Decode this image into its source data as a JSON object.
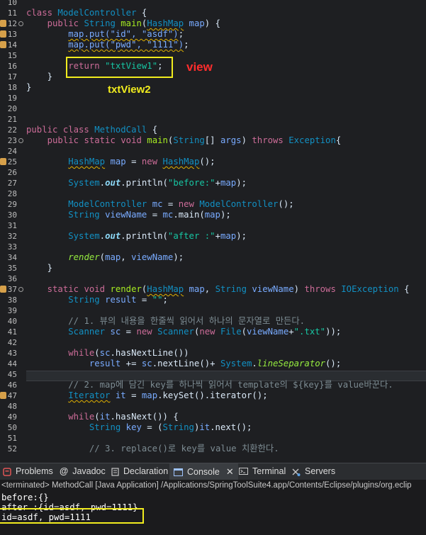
{
  "annotations": {
    "view_label": "view",
    "txtview2_label": "txtView2"
  },
  "colors": {
    "annotation_box": "#f1ec1e",
    "annotation_red": "#ff2d2d",
    "editor_bg": "#1e1f22"
  },
  "editor": {
    "lines": [
      {
        "n": "10",
        "segs": []
      },
      {
        "n": "11",
        "segs": [
          {
            "c": "kw",
            "t": "class "
          },
          {
            "c": "typ",
            "t": "ModelController"
          },
          {
            "t": " {"
          }
        ]
      },
      {
        "n": "12",
        "marker": true,
        "fold": true,
        "segs": [
          {
            "t": "    "
          },
          {
            "c": "kw",
            "t": "public "
          },
          {
            "c": "typ",
            "t": "String "
          },
          {
            "c": "meth",
            "t": "main"
          },
          {
            "t": "("
          },
          {
            "c": "typ warn",
            "t": "HashMap"
          },
          {
            "t": " "
          },
          {
            "c": "var",
            "t": "map"
          },
          {
            "t": ") {"
          }
        ]
      },
      {
        "n": "13",
        "marker": true,
        "segs": [
          {
            "t": "        "
          },
          {
            "c": "var warn",
            "t": "map.put(\"id\", \"asdf\")"
          },
          {
            "t": ";"
          }
        ]
      },
      {
        "n": "14",
        "marker": true,
        "segs": [
          {
            "t": "        "
          },
          {
            "c": "var warn",
            "t": "map.put(\"pwd\", \"1111\")"
          },
          {
            "t": ";"
          }
        ]
      },
      {
        "n": "15",
        "segs": []
      },
      {
        "n": "16",
        "segs": [
          {
            "t": "        "
          },
          {
            "c": "kw",
            "t": "return "
          },
          {
            "c": "str",
            "t": "\"txtView1\""
          },
          {
            "t": ";"
          }
        ]
      },
      {
        "n": "17",
        "segs": [
          {
            "t": "    }"
          }
        ]
      },
      {
        "n": "18",
        "segs": [
          {
            "t": "}"
          }
        ]
      },
      {
        "n": "19",
        "segs": []
      },
      {
        "n": "20",
        "segs": []
      },
      {
        "n": "21",
        "segs": []
      },
      {
        "n": "22",
        "segs": [
          {
            "c": "kw",
            "t": "public class "
          },
          {
            "c": "typ",
            "t": "MethodCall"
          },
          {
            "t": " {"
          }
        ]
      },
      {
        "n": "23",
        "fold": true,
        "segs": [
          {
            "t": "    "
          },
          {
            "c": "kw",
            "t": "public static void "
          },
          {
            "c": "meth",
            "t": "main"
          },
          {
            "t": "("
          },
          {
            "c": "typ",
            "t": "String"
          },
          {
            "t": "[] "
          },
          {
            "c": "var",
            "t": "args"
          },
          {
            "t": ") "
          },
          {
            "c": "kw",
            "t": "throws "
          },
          {
            "c": "typ",
            "t": "Exception"
          },
          {
            "t": "{"
          }
        ]
      },
      {
        "n": "24",
        "segs": []
      },
      {
        "n": "25",
        "marker": true,
        "segs": [
          {
            "t": "        "
          },
          {
            "c": "typ warn",
            "t": "HashMap"
          },
          {
            "t": " "
          },
          {
            "c": "var",
            "t": "map"
          },
          {
            "t": " = "
          },
          {
            "c": "kw",
            "t": "new "
          },
          {
            "c": "typ warn",
            "t": "HashMap"
          },
          {
            "t": "();"
          }
        ]
      },
      {
        "n": "26",
        "segs": []
      },
      {
        "n": "27",
        "segs": [
          {
            "t": "        "
          },
          {
            "c": "typ",
            "t": "System"
          },
          {
            "t": "."
          },
          {
            "c": "field",
            "t": "out"
          },
          {
            "t": ".println("
          },
          {
            "c": "str",
            "t": "\"before:\""
          },
          {
            "t": "+"
          },
          {
            "c": "var",
            "t": "map"
          },
          {
            "t": ");"
          }
        ]
      },
      {
        "n": "28",
        "segs": []
      },
      {
        "n": "29",
        "segs": [
          {
            "t": "        "
          },
          {
            "c": "typ",
            "t": "ModelController "
          },
          {
            "c": "var",
            "t": "mc"
          },
          {
            "t": " = "
          },
          {
            "c": "kw",
            "t": "new "
          },
          {
            "c": "typ",
            "t": "ModelController"
          },
          {
            "t": "();"
          }
        ]
      },
      {
        "n": "30",
        "segs": [
          {
            "t": "        "
          },
          {
            "c": "typ",
            "t": "String "
          },
          {
            "c": "var",
            "t": "viewName"
          },
          {
            "t": " = "
          },
          {
            "c": "var",
            "t": "mc"
          },
          {
            "t": ".main("
          },
          {
            "c": "var",
            "t": "map"
          },
          {
            "t": ");"
          }
        ]
      },
      {
        "n": "31",
        "segs": []
      },
      {
        "n": "32",
        "segs": [
          {
            "t": "        "
          },
          {
            "c": "typ",
            "t": "System"
          },
          {
            "t": "."
          },
          {
            "c": "field",
            "t": "out"
          },
          {
            "t": ".println("
          },
          {
            "c": "str",
            "t": "\"after :\""
          },
          {
            "t": "+"
          },
          {
            "c": "var",
            "t": "map"
          },
          {
            "t": ");"
          }
        ]
      },
      {
        "n": "33",
        "segs": []
      },
      {
        "n": "34",
        "segs": [
          {
            "t": "        "
          },
          {
            "c": "ital",
            "t": "render"
          },
          {
            "t": "("
          },
          {
            "c": "var",
            "t": "map"
          },
          {
            "t": ", "
          },
          {
            "c": "var",
            "t": "viewName"
          },
          {
            "t": ");"
          }
        ]
      },
      {
        "n": "35",
        "segs": [
          {
            "t": "    }"
          }
        ]
      },
      {
        "n": "36",
        "segs": []
      },
      {
        "n": "37",
        "marker": true,
        "fold": true,
        "segs": [
          {
            "t": "    "
          },
          {
            "c": "kw",
            "t": "static void "
          },
          {
            "c": "meth",
            "t": "render"
          },
          {
            "t": "("
          },
          {
            "c": "typ warn",
            "t": "HashMap"
          },
          {
            "t": " "
          },
          {
            "c": "var",
            "t": "map"
          },
          {
            "t": ", "
          },
          {
            "c": "typ",
            "t": "String "
          },
          {
            "c": "var",
            "t": "viewName"
          },
          {
            "t": ") "
          },
          {
            "c": "kw",
            "t": "throws "
          },
          {
            "c": "typ",
            "t": "IOException"
          },
          {
            "t": " {"
          }
        ]
      },
      {
        "n": "38",
        "segs": [
          {
            "t": "        "
          },
          {
            "c": "typ",
            "t": "String "
          },
          {
            "c": "var",
            "t": "result"
          },
          {
            "t": " = "
          },
          {
            "c": "str",
            "t": "\"\""
          },
          {
            "t": ";"
          }
        ]
      },
      {
        "n": "39",
        "segs": []
      },
      {
        "n": "40",
        "segs": [
          {
            "t": "        "
          },
          {
            "c": "cmt",
            "t": "// 1. 뷰의 내용을 한줄씩 읽어서 하나의 문자열로 만든다."
          }
        ]
      },
      {
        "n": "41",
        "segs": [
          {
            "t": "        "
          },
          {
            "c": "typ",
            "t": "Scanner "
          },
          {
            "c": "var",
            "t": "sc"
          },
          {
            "t": " = "
          },
          {
            "c": "kw",
            "t": "new "
          },
          {
            "c": "typ",
            "t": "Scanner"
          },
          {
            "t": "("
          },
          {
            "c": "kw",
            "t": "new "
          },
          {
            "c": "typ",
            "t": "File"
          },
          {
            "t": "("
          },
          {
            "c": "var",
            "t": "viewName"
          },
          {
            "t": "+"
          },
          {
            "c": "str",
            "t": "\".txt\""
          },
          {
            "t": "));"
          }
        ]
      },
      {
        "n": "42",
        "segs": []
      },
      {
        "n": "43",
        "segs": [
          {
            "t": "        "
          },
          {
            "c": "kw",
            "t": "while"
          },
          {
            "t": "("
          },
          {
            "c": "var",
            "t": "sc"
          },
          {
            "t": ".hasNextLine())"
          }
        ]
      },
      {
        "n": "44",
        "segs": [
          {
            "t": "            "
          },
          {
            "c": "var",
            "t": "result"
          },
          {
            "t": " += "
          },
          {
            "c": "var",
            "t": "sc"
          },
          {
            "t": ".nextLine()+ "
          },
          {
            "c": "typ",
            "t": "System"
          },
          {
            "t": "."
          },
          {
            "c": "ital",
            "t": "lineSeparator"
          },
          {
            "t": "();"
          }
        ]
      },
      {
        "n": "45",
        "segs": []
      },
      {
        "n": "46",
        "segs": [
          {
            "t": "        "
          },
          {
            "c": "cmt",
            "t": "// 2. map에 담긴 key를 하나씩 읽어서 template의 ${key}를 value바꾼다."
          }
        ]
      },
      {
        "n": "47",
        "marker": true,
        "segs": [
          {
            "t": "        "
          },
          {
            "c": "typ warn",
            "t": "Iterator"
          },
          {
            "t": " "
          },
          {
            "c": "var",
            "t": "it"
          },
          {
            "t": " = "
          },
          {
            "c": "var",
            "t": "map"
          },
          {
            "t": ".keySet().iterator();"
          }
        ]
      },
      {
        "n": "48",
        "segs": []
      },
      {
        "n": "49",
        "segs": [
          {
            "t": "        "
          },
          {
            "c": "kw",
            "t": "while"
          },
          {
            "t": "("
          },
          {
            "c": "var",
            "t": "it"
          },
          {
            "t": ".hasNext()) {"
          }
        ]
      },
      {
        "n": "50",
        "segs": [
          {
            "t": "            "
          },
          {
            "c": "typ",
            "t": "String "
          },
          {
            "c": "var",
            "t": "key"
          },
          {
            "t": " = ("
          },
          {
            "c": "typ",
            "t": "String"
          },
          {
            "t": ")"
          },
          {
            "c": "var",
            "t": "it"
          },
          {
            "t": ".next();"
          }
        ]
      },
      {
        "n": "51",
        "segs": []
      },
      {
        "n": "52",
        "segs": [
          {
            "t": "            "
          },
          {
            "c": "cmt",
            "t": "// 3. replace()로 key를 value 치환한다."
          }
        ]
      }
    ]
  },
  "panel": {
    "tabs": [
      {
        "name": "tab-problems",
        "label": "Problems",
        "icon": "problems-icon"
      },
      {
        "name": "tab-javadoc",
        "label": "Javadoc",
        "icon": "javadoc-icon"
      },
      {
        "name": "tab-declaration",
        "label": "Declaration",
        "icon": "declaration-icon"
      },
      {
        "name": "tab-console",
        "label": "Console",
        "icon": "console-icon",
        "active": true
      },
      {
        "name": "tab-terminal",
        "label": "Terminal",
        "icon": "terminal-icon"
      },
      {
        "name": "tab-servers",
        "label": "Servers",
        "icon": "servers-icon"
      }
    ],
    "console_status": "<terminated> MethodCall [Java Application] /Applications/SpringToolSuite4.app/Contents/Eclipse/plugins/org.eclip",
    "output_lines": [
      "before:{}",
      "after :{id=asdf, pwd=1111}",
      "id=asdf, pwd=1111"
    ]
  }
}
